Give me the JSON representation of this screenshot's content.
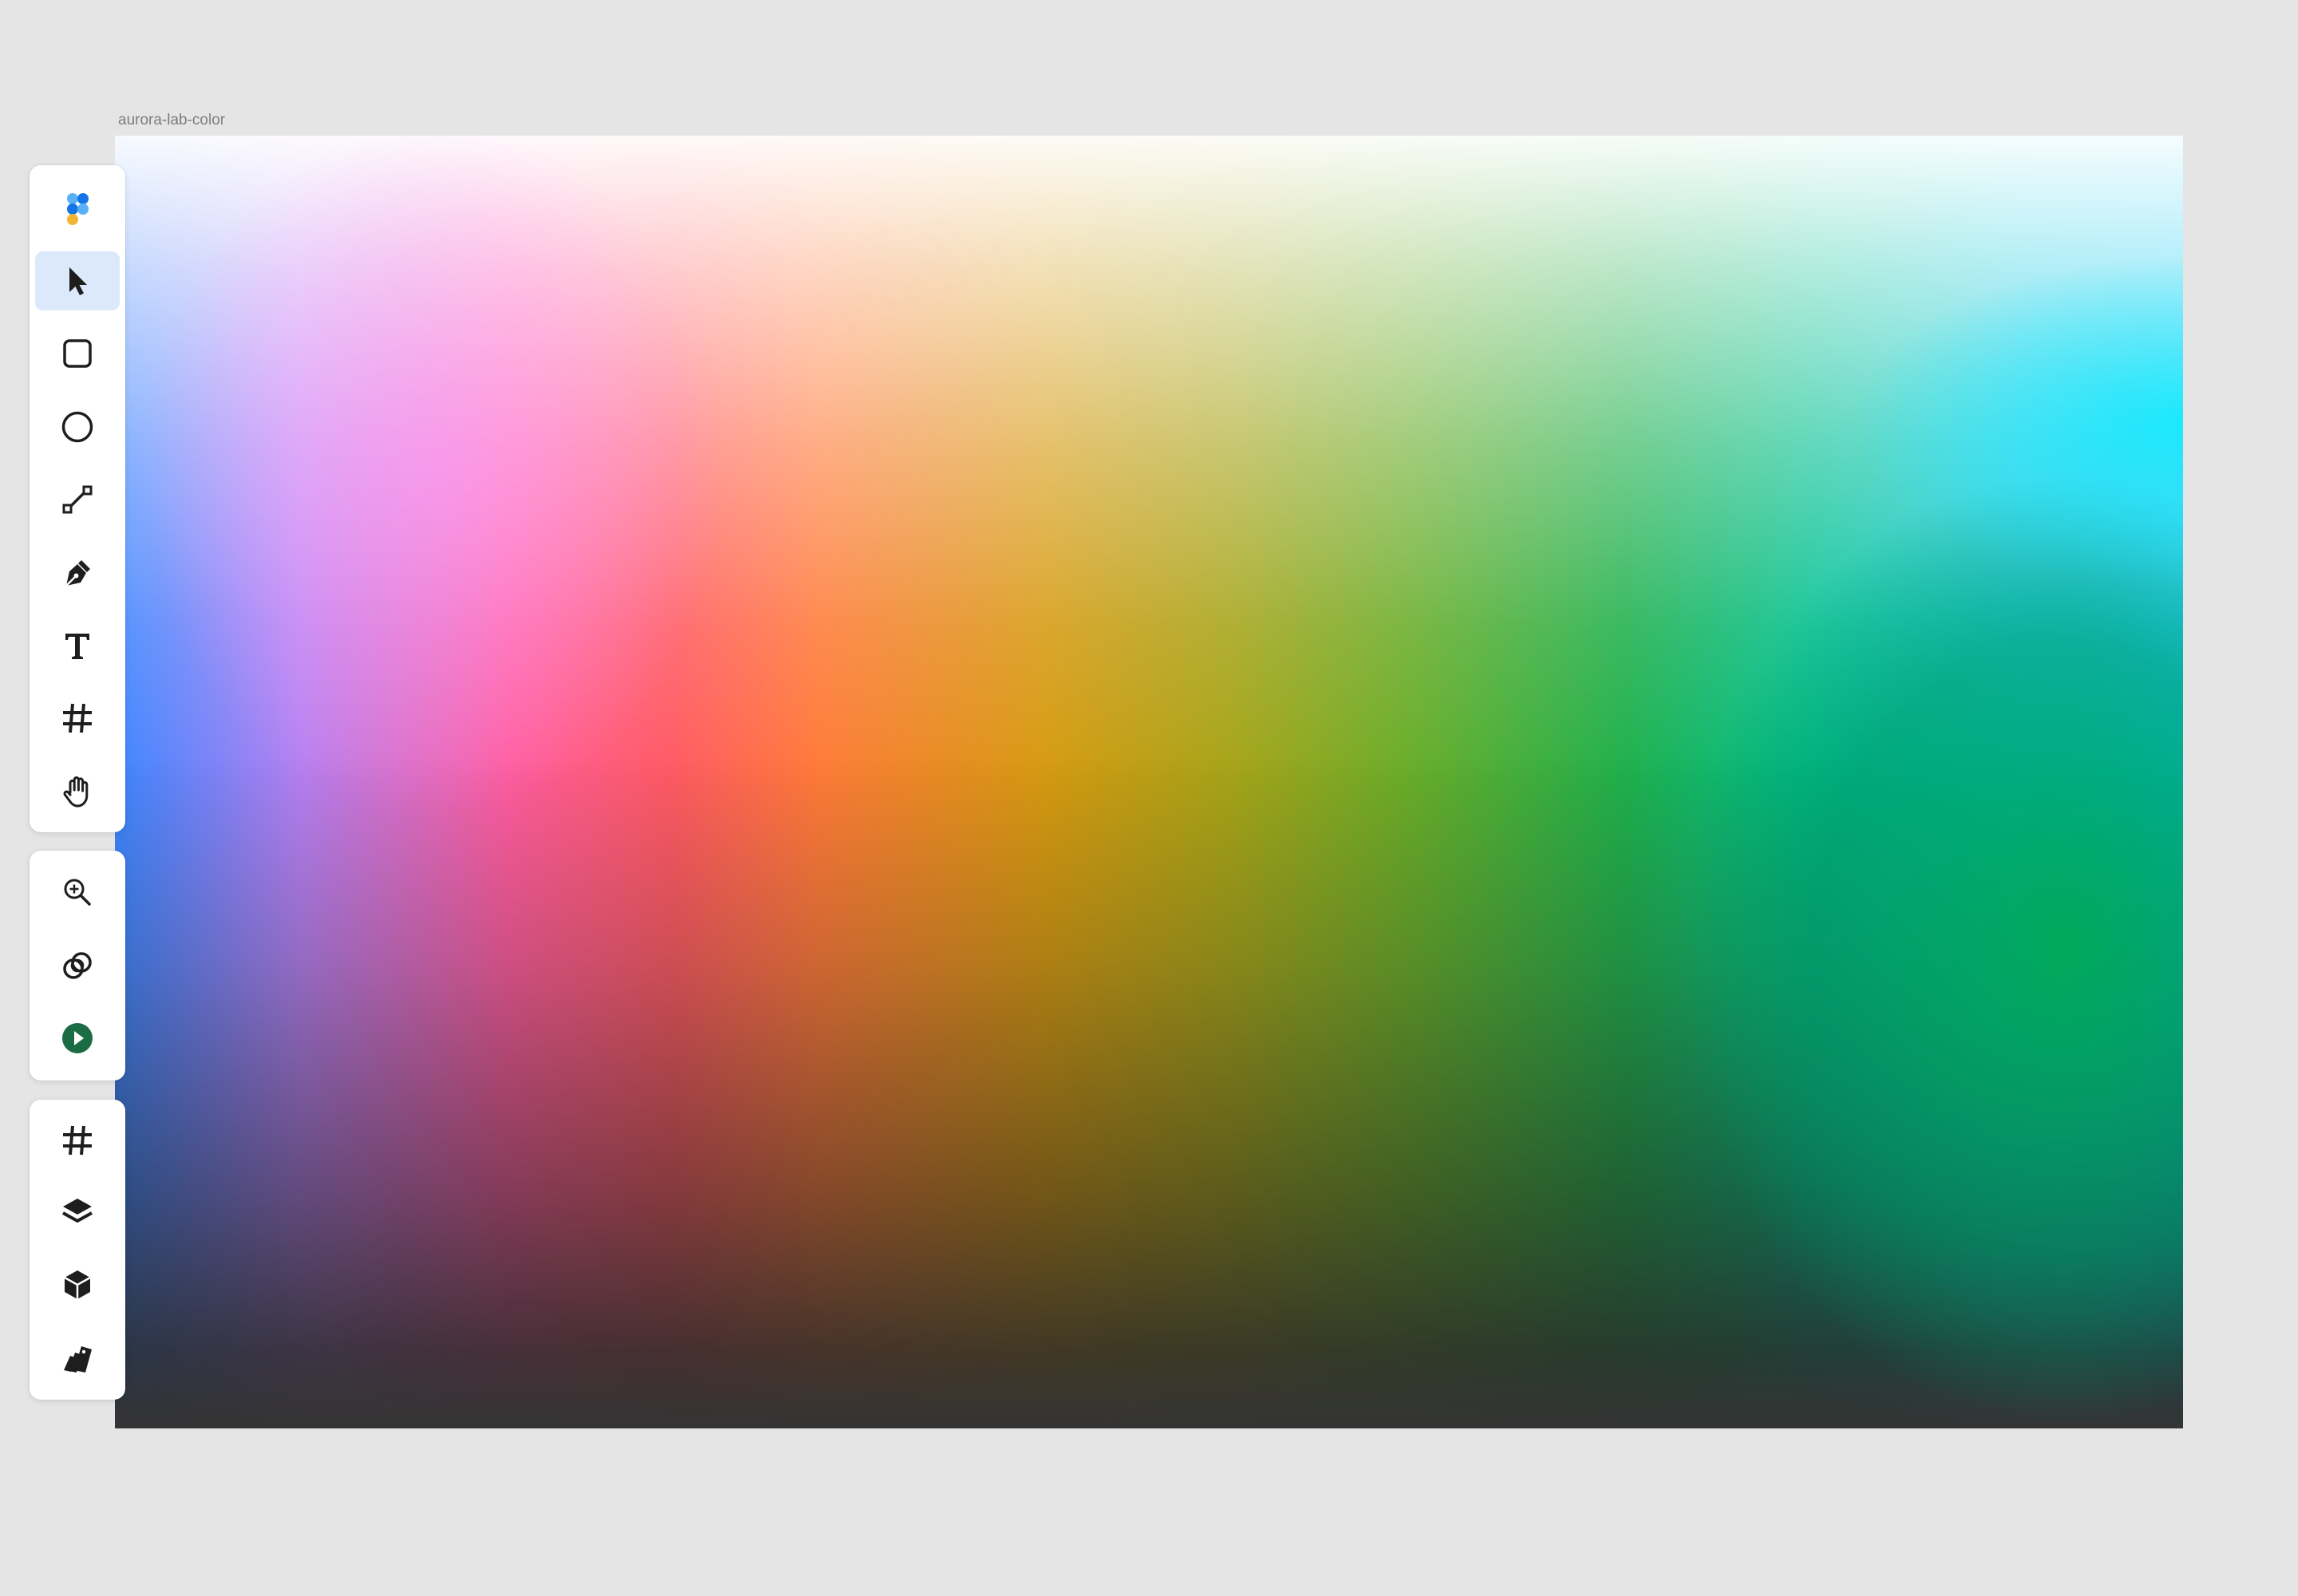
{
  "frame": {
    "label": "aurora-lab-color"
  },
  "colors": {
    "app_background": "#e5e5e5",
    "toolbar_background": "#ffffff",
    "active_tool_background": "#dbe9fb",
    "icon_color": "#1e1e1e",
    "play_button": "#1b6b44",
    "logo_blue_dark": "#1474e8",
    "logo_blue_light": "#5ab0f5",
    "logo_yellow": "#f5b533",
    "gradient_stops": [
      "#f3f5fb",
      "#ffaaff",
      "#ff6070",
      "#ffaa40",
      "#b08c00",
      "#6a9a10",
      "#00b050",
      "#00e5ff",
      "#333333"
    ]
  },
  "toolbar": {
    "active_tool": "move",
    "groups": [
      {
        "id": "tools",
        "items": [
          {
            "id": "logo",
            "icon": "app-logo-icon"
          },
          {
            "id": "move",
            "icon": "cursor-arrow-icon",
            "active": true
          },
          {
            "id": "rectangle",
            "icon": "rectangle-icon"
          },
          {
            "id": "ellipse",
            "icon": "ellipse-icon"
          },
          {
            "id": "line",
            "icon": "line-icon"
          },
          {
            "id": "pen",
            "icon": "pen-icon"
          },
          {
            "id": "text",
            "icon": "text-icon"
          },
          {
            "id": "frame",
            "icon": "hash-icon"
          },
          {
            "id": "hand",
            "icon": "hand-icon"
          }
        ]
      },
      {
        "id": "view",
        "items": [
          {
            "id": "zoom",
            "icon": "zoom-in-icon"
          },
          {
            "id": "boolean",
            "icon": "overlap-circles-icon"
          },
          {
            "id": "present",
            "icon": "play-icon"
          }
        ]
      },
      {
        "id": "panels",
        "items": [
          {
            "id": "grid",
            "icon": "hash-icon"
          },
          {
            "id": "layers",
            "icon": "layers-icon"
          },
          {
            "id": "assets",
            "icon": "cube-icon"
          },
          {
            "id": "swatches",
            "icon": "swatches-icon"
          }
        ]
      }
    ]
  }
}
